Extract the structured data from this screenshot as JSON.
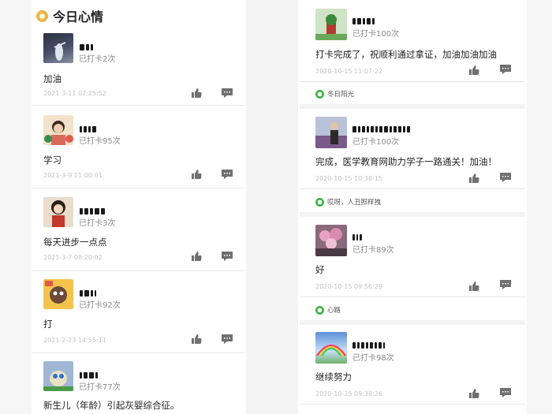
{
  "header": {
    "title": "今日心情"
  },
  "left_entries": [
    {
      "checkin": "已打卡2次",
      "content": "加油",
      "time": "2021-3-11 07:25:52"
    },
    {
      "checkin": "已打卡95次",
      "content": "学习",
      "time": "2021-3-9 11:00:01"
    },
    {
      "checkin": "已打卡3次",
      "content": "每天进步一点点",
      "time": "2021-3-7 08:20:02"
    },
    {
      "checkin": "已打卡92次",
      "content": "打",
      "time": "2021-2-23 14:55:11"
    },
    {
      "checkin": "已打卡77次",
      "content": "新生儿（年龄）引起灰婴综合征。"
    }
  ],
  "right_entries": [
    {
      "checkin": "已打卡100次",
      "content": "打卡完成了，祝顺利通过拿证，加油加油加油",
      "time": "2020-10-15 11:07:22",
      "liked_by": "冬日阳光"
    },
    {
      "checkin": "已打卡100次",
      "content": "完成，医学教育网助力学子一路通关！加油！",
      "time": "2020-10-15 10:38:15",
      "liked_by": "哎呀，人丑照样拽"
    },
    {
      "checkin": "已打卡89次",
      "content": "好",
      "time": "2020-10-15 09:56:29",
      "liked_by": "心路"
    },
    {
      "checkin": "已打卡98次",
      "content": "继续努力",
      "time": "2020-10-15 09:38:26"
    }
  ],
  "icons": {
    "like": "thumbs-up-icon",
    "comment": "comment-icon",
    "liked": "liked-badge-icon"
  },
  "colors": {
    "accent_green": "#43b44a",
    "header_icon": "#e9b54b"
  }
}
